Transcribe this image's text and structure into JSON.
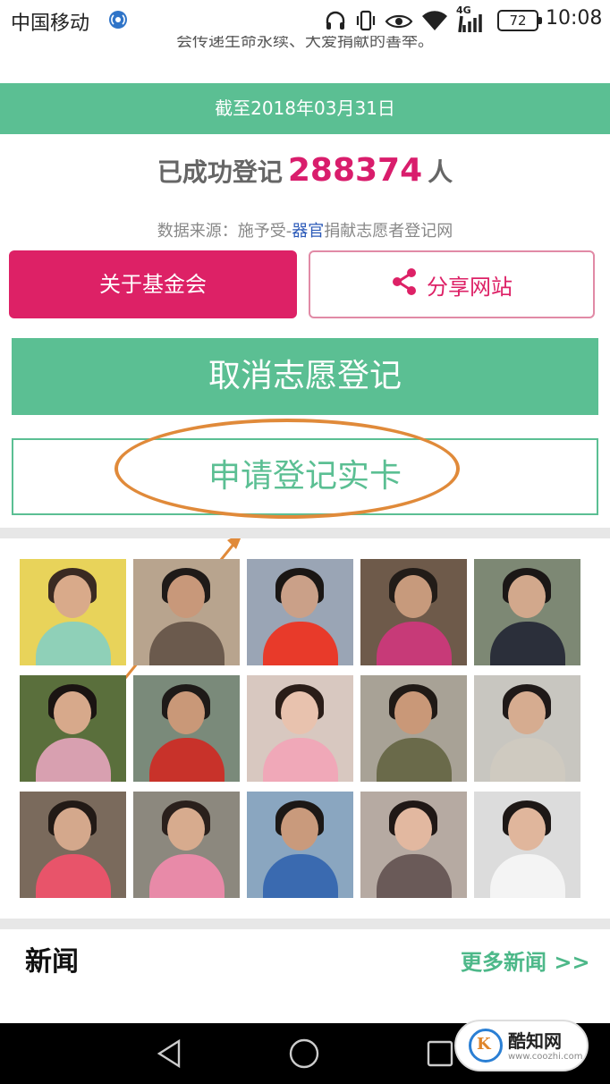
{
  "status_bar": {
    "carrier": "中国移动",
    "network": "4G",
    "battery": "72",
    "time": "10:08"
  },
  "header": {
    "cut_text": "会传递生命永续、大爱捐献的善举。",
    "date_banner": "截至2018年03月31日"
  },
  "registration": {
    "prefix": "已成功登记",
    "count": "288374",
    "suffix": "人",
    "source_prefix": "数据来源：施予受-",
    "source_highlight": "器官",
    "source_suffix": "捐献志愿者登记网"
  },
  "buttons": {
    "about": "关于基金会",
    "share": "分享网站",
    "cancel": "取消志愿登记",
    "apply": "申请登记实卡"
  },
  "photos": [
    {
      "bg": "#e8d35a",
      "skin": "#d9aa8a",
      "hair": "#3a2a22",
      "cloth": "#8fd0b8"
    },
    {
      "bg": "#b8a48e",
      "skin": "#c8987a",
      "hair": "#1f1a18",
      "cloth": "#6b5a4d"
    },
    {
      "bg": "#9aa5b5",
      "skin": "#caa088",
      "hair": "#1a1614",
      "cloth": "#e83a2a"
    },
    {
      "bg": "#6e5a4a",
      "skin": "#c79a7c",
      "hair": "#221c18",
      "cloth": "#c73a78"
    },
    {
      "bg": "#7d8874",
      "skin": "#d2a88c",
      "hair": "#1b1716",
      "cloth": "#2b2f3a"
    },
    {
      "bg": "#5a6f3c",
      "skin": "#d7a98b",
      "hair": "#1a1412",
      "cloth": "#d8a0b0"
    },
    {
      "bg": "#7a8a7a",
      "skin": "#c99878",
      "hair": "#1e1a18",
      "cloth": "#c8322a"
    },
    {
      "bg": "#d8c8c0",
      "skin": "#e8c2ae",
      "hair": "#2a1d18",
      "cloth": "#f0a8b8"
    },
    {
      "bg": "#a8a296",
      "skin": "#c99878",
      "hair": "#201a16",
      "cloth": "#6a6a4a"
    },
    {
      "bg": "#c8c6c0",
      "skin": "#d6ac90",
      "hair": "#1f1918",
      "cloth": "#cfcac0"
    },
    {
      "bg": "#7a6a5c",
      "skin": "#d4a88c",
      "hair": "#221a16",
      "cloth": "#e8546a"
    },
    {
      "bg": "#8c887e",
      "skin": "#d7ab8e",
      "hair": "#2a201c",
      "cloth": "#e88aa8"
    },
    {
      "bg": "#8aa6c0",
      "skin": "#c99a7c",
      "hair": "#1c1816",
      "cloth": "#3a6ab0"
    },
    {
      "bg": "#b6aaa2",
      "skin": "#e2b8a0",
      "hair": "#201816",
      "cloth": "#6a5a58"
    },
    {
      "bg": "#dcdcdc",
      "skin": "#e0b69c",
      "hair": "#1e1816",
      "cloth": "#f4f4f4"
    }
  ],
  "news": {
    "title": "新闻",
    "more": "更多新闻 >>"
  },
  "watermark": {
    "logo_letter": "K",
    "name": "酷知网",
    "url": "www.coozhi.com"
  },
  "colors": {
    "accent_green": "#5bbf93",
    "accent_pink": "#dd2166",
    "annotation_orange": "#e08a3a"
  }
}
